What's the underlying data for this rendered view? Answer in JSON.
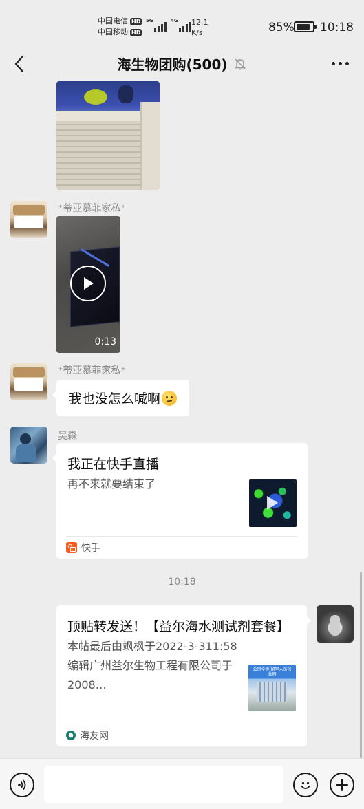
{
  "status_bar": {
    "carrier1": "中国电信",
    "carrier2": "中国移动",
    "hd_label": "HD",
    "net1": "5G",
    "net2": "4G",
    "speed_value": "12.1",
    "speed_unit": "K/s",
    "battery_text": "85%",
    "battery_level": 0.85,
    "time": "10:18"
  },
  "nav": {
    "title": "海生物团购(500)",
    "back_icon": "chevron-left-icon",
    "mute_icon": "bell-off-icon",
    "more_icon": "more-dots-icon"
  },
  "messages": {
    "video": {
      "sender": "⁺蒂亚慕菲家私⁺",
      "duration": "0:13"
    },
    "text": {
      "sender": "⁺蒂亚慕菲家私⁺",
      "content": "我也没怎么喊啊",
      "emoji": "thinking-face-icon"
    },
    "kuaishou": {
      "sender": "吴森",
      "title": "我正在快手直播",
      "desc": "再不来就要结束了",
      "source": "快手"
    },
    "timestamp": "10:18",
    "haiyou": {
      "title": "顶贴转发送！【益尔海水测试剂套餐】",
      "desc": "本帖最后由飒枫于2022-3-311:58编辑广州益尔生物工程有限公司于2008…",
      "thumb_caption": "公司全称 留学人员创业园",
      "source": "海友网"
    }
  },
  "input_bar": {
    "placeholder": "",
    "voice_icon": "voice-icon",
    "emoji_icon": "emoji-icon",
    "plus_icon": "plus-icon"
  }
}
